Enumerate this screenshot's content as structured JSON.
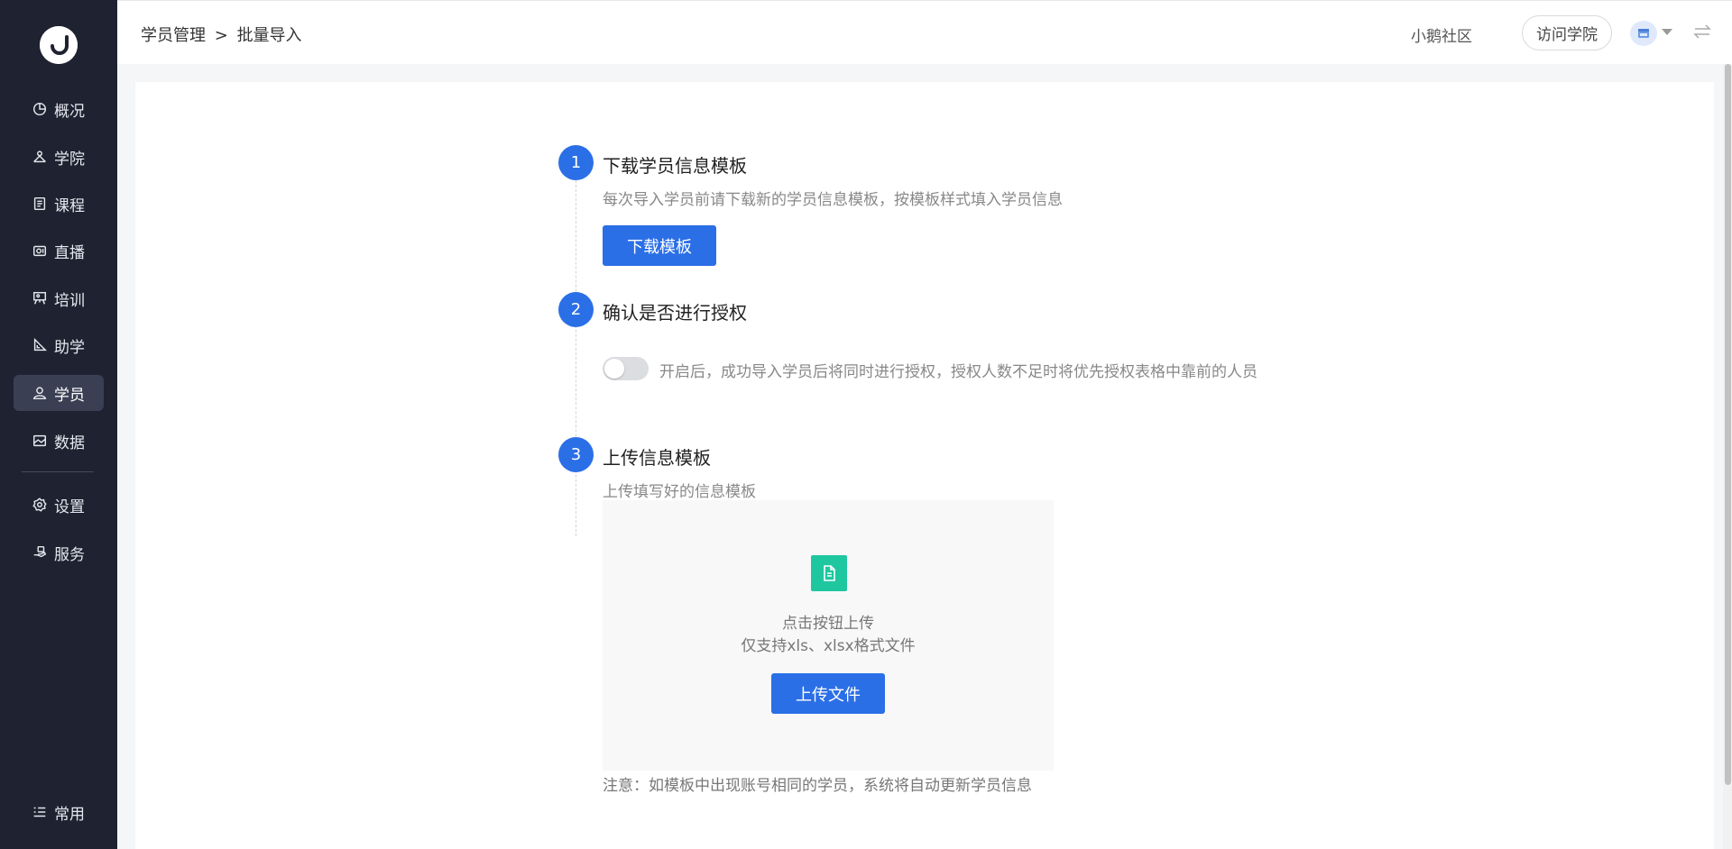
{
  "sidebar": {
    "items": [
      {
        "label": "概况",
        "icon": "pie-chart-icon"
      },
      {
        "label": "学院",
        "icon": "academy-icon"
      },
      {
        "label": "课程",
        "icon": "document-icon"
      },
      {
        "label": "直播",
        "icon": "live-camera-icon"
      },
      {
        "label": "培训",
        "icon": "training-board-icon"
      },
      {
        "label": "助学",
        "icon": "ruler-icon"
      },
      {
        "label": "学员",
        "icon": "user-icon",
        "active": true
      },
      {
        "label": "数据",
        "icon": "image-chart-icon"
      },
      {
        "label": "设置",
        "icon": "gear-icon"
      },
      {
        "label": "服务",
        "icon": "hand-service-icon"
      },
      {
        "label": "常用",
        "icon": "list-icon"
      }
    ]
  },
  "header": {
    "breadcrumb": {
      "parent": "学员管理",
      "separator": ">",
      "current": "批量导入"
    },
    "community": "小鹅社区",
    "visit_button": "访问学院"
  },
  "steps": [
    {
      "num": "1",
      "title": "下载学员信息模板",
      "desc": "每次导入学员前请下载新的学员信息模板，按模板样式填入学员信息",
      "button": "下载模板"
    },
    {
      "num": "2",
      "title": "确认是否进行授权",
      "toggle_text": "开启后，成功导入学员后将同时进行授权，授权人数不足时将优先授权表格中靠前的人员",
      "toggle_on": false
    },
    {
      "num": "3",
      "title": "上传信息模板",
      "desc": "上传填写好的信息模板"
    }
  ],
  "upload": {
    "hint_line1": "点击按钮上传",
    "hint_line2": "仅支持xls、xlsx格式文件",
    "button": "上传文件"
  },
  "note": "注意：如模板中出现账号相同的学员，系统将自动更新学员信息",
  "colors": {
    "sidebar_bg": "#1f2231",
    "primary": "#2b6fe6",
    "file_icon": "#1ec7a0"
  }
}
